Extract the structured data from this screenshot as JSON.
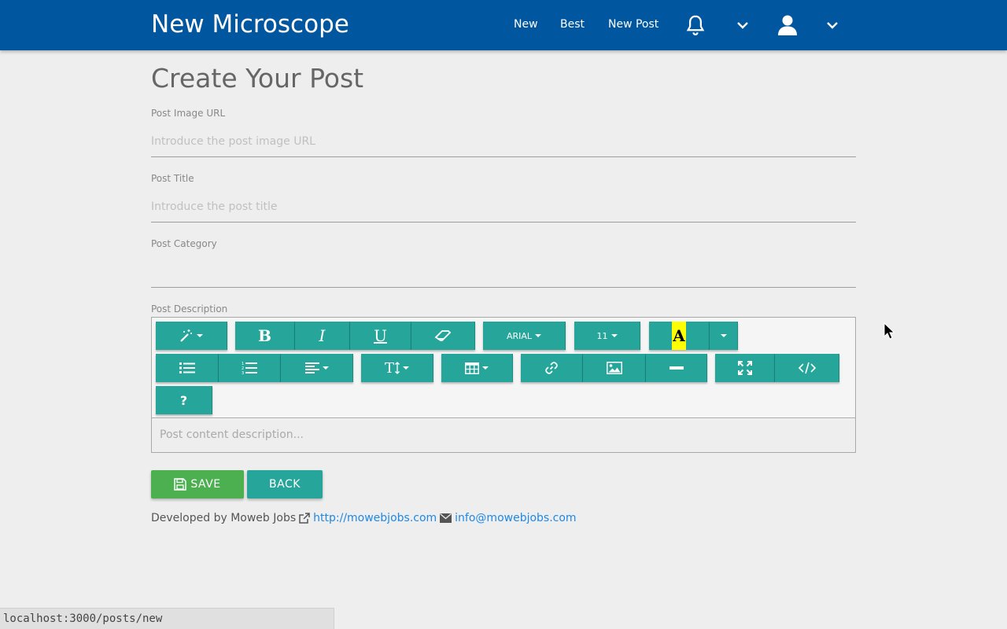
{
  "navbar": {
    "brand": "New Microscope",
    "links": [
      {
        "label": "New"
      },
      {
        "label": "Best"
      },
      {
        "label": "New Post"
      }
    ],
    "icons": [
      "bell-icon",
      "chevron-down-icon",
      "user-icon",
      "chevron-down-icon"
    ],
    "bg_color": "#0057a0"
  },
  "page": {
    "title": "Create Your Post"
  },
  "form": {
    "image_url": {
      "label": "Post Image URL",
      "placeholder": "Introduce the post image URL",
      "value": ""
    },
    "title": {
      "label": "Post Title",
      "placeholder": "Introduce the post title",
      "value": ""
    },
    "category": {
      "label": "Post Category",
      "value": ""
    },
    "description": {
      "label": "Post Description",
      "placeholder": "Post content description...",
      "toolbar": {
        "font_family": "ARIAL",
        "font_size": "11",
        "highlight_letter": "A",
        "bold_letter": "B",
        "italic_letter": "I",
        "underline_letter": "U",
        "help_label": "?",
        "text_height_label": "T"
      }
    }
  },
  "actions": {
    "save_label": "SAVE",
    "back_label": "BACK",
    "save_color": "#4caf50",
    "accent_color": "#26a69a"
  },
  "footer": {
    "developed_by": "Developed by Moweb Jobs",
    "website": "http://mowebjobs.com",
    "email": "info@mowebjobs.com"
  },
  "status_bar": {
    "url": "localhost:3000/posts/new"
  }
}
